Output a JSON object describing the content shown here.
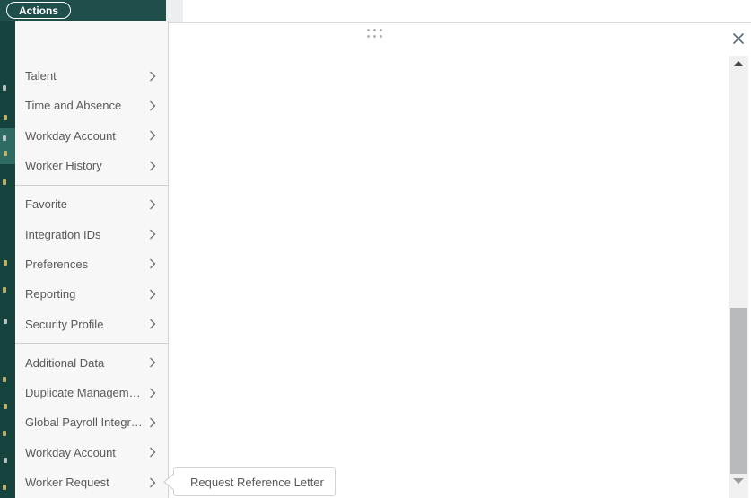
{
  "header": {
    "actions_button": "Actions"
  },
  "menu": {
    "groups": [
      {
        "items": [
          {
            "label": "Talent"
          },
          {
            "label": "Time and Absence"
          },
          {
            "label": "Workday Account"
          },
          {
            "label": "Worker History"
          }
        ]
      },
      {
        "items": [
          {
            "label": "Favorite"
          },
          {
            "label": "Integration IDs"
          },
          {
            "label": "Preferences"
          },
          {
            "label": "Reporting"
          },
          {
            "label": "Security Profile"
          }
        ]
      },
      {
        "items": [
          {
            "label": "Additional Data"
          },
          {
            "label": "Duplicate Management"
          },
          {
            "label": "Global Payroll Integrati…"
          },
          {
            "label": "Workday Account"
          },
          {
            "label": "Worker Request"
          }
        ]
      }
    ]
  },
  "submenu": {
    "items": [
      {
        "label": "Request Reference Letter"
      }
    ]
  },
  "icons": {
    "chevron_right": "›",
    "close": "✕",
    "drag_handle_dots": "⠿",
    "scroll_up_arrow": "▲",
    "scroll_down_arrow": "▼"
  },
  "colors": {
    "header_teal": "#1e4f4a",
    "sidebar_teal_dark": "#17433e",
    "sidebar_teal_highlight": "#2e6b62",
    "menu_panel_bg": "#f7f7f8",
    "menu_text": "#595959",
    "divider": "#cfd0d2",
    "scroll_thumb": "#b9babb",
    "close_icon": "#5d6b7a"
  }
}
